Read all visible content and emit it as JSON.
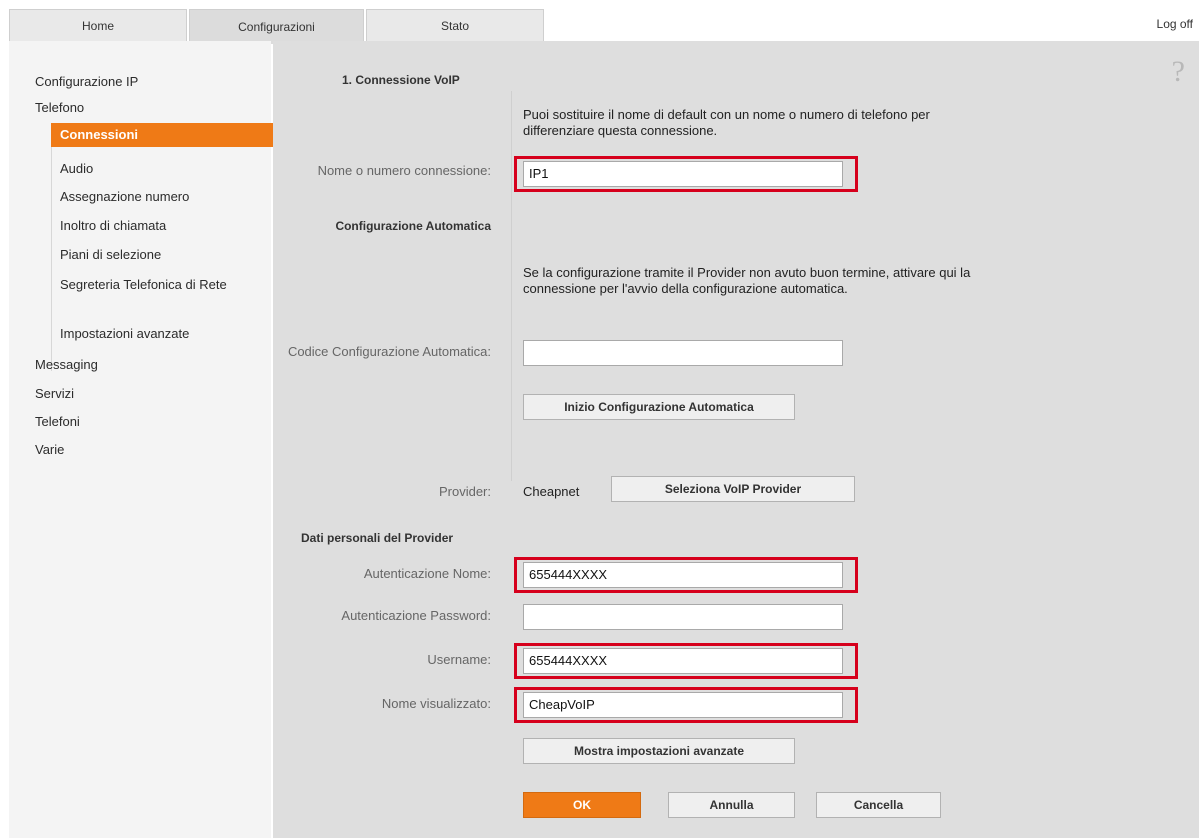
{
  "tabs": [
    {
      "label": "Home"
    },
    {
      "label": "Configurazioni"
    },
    {
      "label": "Stato"
    }
  ],
  "logoff": "Log off",
  "help_icon": "help-question-icon",
  "sidebar": {
    "items": [
      {
        "label": "Configurazione IP"
      },
      {
        "label": "Telefono"
      },
      {
        "label": "Connessioni"
      },
      {
        "label": "Audio"
      },
      {
        "label": "Assegnazione numero"
      },
      {
        "label": "Inoltro di chiamata"
      },
      {
        "label": "Piani di selezione"
      },
      {
        "label": "Segreteria Telefonica di Rete"
      },
      {
        "label": "Impostazioni avanzate"
      },
      {
        "label": "Messaging"
      },
      {
        "label": "Servizi"
      },
      {
        "label": "Telefoni"
      },
      {
        "label": "Varie"
      }
    ]
  },
  "main": {
    "section1_title": "1. Connessione VoIP",
    "desc_name": "Puoi sostituire il nome di default con un nome o numero di telefono per differenziare questa connessione.",
    "name_label": "Nome o numero connessione:",
    "name_value": "IP1",
    "auto_config_title": "Configurazione Automatica",
    "desc_auto": "Se la configurazione tramite il Provider non avuto buon termine, attivare qui la connessione per l'avvio della configurazione automatica.",
    "auto_code_label": "Codice Configurazione Automatica:",
    "auto_code_value": "",
    "start_auto_button": "Inizio Configurazione Automatica",
    "provider_label": "Provider:",
    "provider_value": "Cheapnet",
    "select_provider_button": "Seleziona VoIP Provider",
    "section2_title": "Dati personali del Provider",
    "auth_name_label": "Autenticazione Nome:",
    "auth_name_value": "655444XXXX",
    "auth_password_label": "Autenticazione Password:",
    "auth_password_value": "",
    "username_label": "Username:",
    "username_value": "655444XXXX",
    "display_name_label": "Nome visualizzato:",
    "display_name_value": "CheapVoIP",
    "advanced_button": "Mostra impostazioni avanzate",
    "ok_button": "OK",
    "annulla_button": "Annulla",
    "cancella_button": "Cancella"
  },
  "colors": {
    "accent": "#ef7a16",
    "highlight": "#d6001c"
  }
}
